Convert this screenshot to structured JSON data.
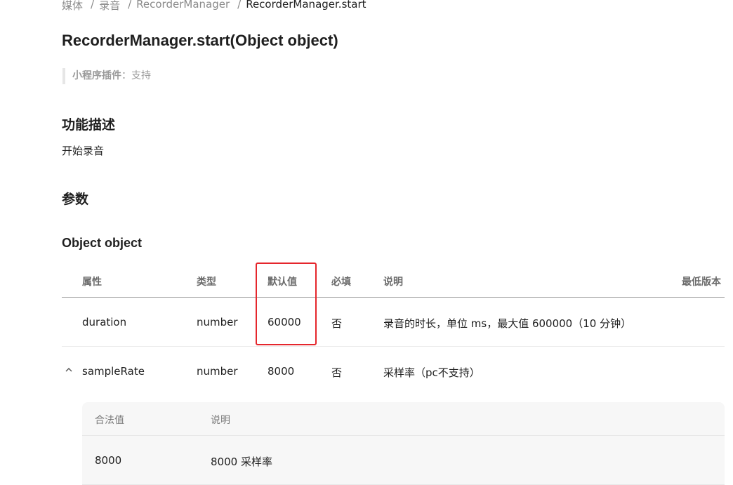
{
  "breadcrumb": {
    "items": [
      "媒体",
      "录音",
      "RecorderManager"
    ],
    "separator": "/",
    "current": "RecorderManager.start"
  },
  "page_title": "RecorderManager.start(Object object)",
  "support_note": {
    "label": "小程序插件",
    "value": "：支持"
  },
  "sections": {
    "function_desc_title": "功能描述",
    "function_desc": "开始录音",
    "params_title": "参数",
    "object_title": "Object object"
  },
  "table": {
    "headers": {
      "name": "属性",
      "type": "类型",
      "default": "默认值",
      "required": "必填",
      "desc": "说明",
      "min_version": "最低版本"
    },
    "rows": [
      {
        "name": "duration",
        "type": "number",
        "default": "60000",
        "required": "否",
        "desc": "录音的时长，单位 ms，最大值 600000（10 分钟）"
      },
      {
        "name": "sampleRate",
        "type": "number",
        "default": "8000",
        "required": "否",
        "desc": "采样率（pc不支持）",
        "expanded": true
      }
    ]
  },
  "nested_table": {
    "headers": {
      "value": "合法值",
      "desc": "说明"
    },
    "rows": [
      {
        "value": "8000",
        "desc": "8000 采样率"
      }
    ]
  },
  "colors": {
    "highlight_border": "#e5262c",
    "text_primary": "#1f1f1f",
    "text_muted": "#8a8a8a",
    "nested_bg": "#f7f7f7"
  }
}
